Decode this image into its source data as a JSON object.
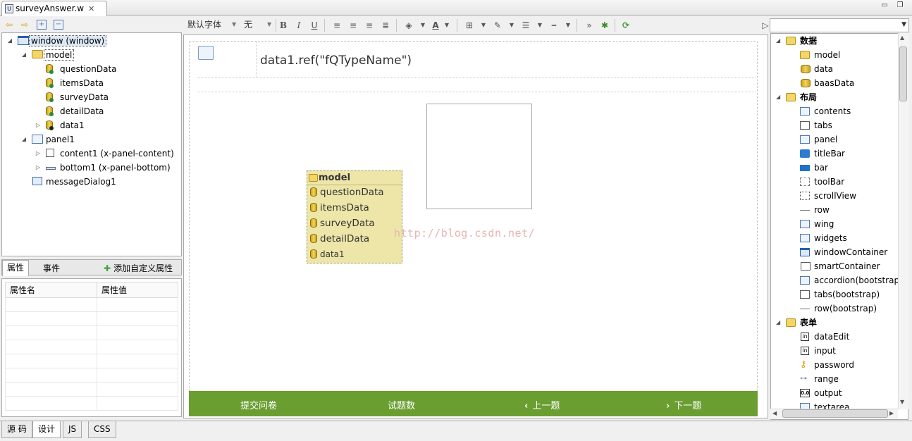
{
  "editor": {
    "tab_title": "surveyAnswer.w",
    "tab_close": "✕"
  },
  "outline": {
    "items": [
      {
        "label": "window (window)"
      },
      {
        "label": "model"
      },
      {
        "label": "questionData"
      },
      {
        "label": "itemsData"
      },
      {
        "label": "surveyData"
      },
      {
        "label": "detailData"
      },
      {
        "label": "data1"
      },
      {
        "label": "panel1"
      },
      {
        "label": "content1 (x-panel-content)"
      },
      {
        "label": "bottom1 (x-panel-bottom)"
      },
      {
        "label": "messageDialog1"
      }
    ]
  },
  "properties": {
    "tabs": [
      "属性",
      "事件"
    ],
    "add_custom": "添加自定义属性",
    "columns": [
      "属性名",
      "属性值"
    ]
  },
  "bottom_tabs": [
    "源 码",
    "设计",
    "JS",
    "CSS"
  ],
  "format_toolbar": {
    "font_family": "默认字体",
    "font_size": "无"
  },
  "canvas": {
    "ref_text": "data1.ref(\"fQTypeName\")",
    "model_box": {
      "title": "model",
      "items": [
        "questionData",
        "itemsData",
        "surveyData",
        "detailData",
        "data1"
      ]
    },
    "watermark": "http://blog.csdn.net/",
    "green_bar": {
      "submit": "提交问卷",
      "count": "试题数",
      "prev": "上一题",
      "next": "下一题"
    }
  },
  "palette": {
    "categories": [
      {
        "name": "数据",
        "items": [
          "model",
          "data",
          "baasData"
        ]
      },
      {
        "name": "布局",
        "items": [
          "contents",
          "tabs",
          "panel",
          "titleBar",
          "bar",
          "toolBar",
          "scrollView",
          "row",
          "wing",
          "widgets",
          "windowContainer",
          "smartContainer",
          "accordion(bootstrap",
          "tabs(bootstrap)",
          "row(bootstrap)"
        ]
      },
      {
        "name": "表单",
        "items": [
          "dataEdit",
          "input",
          "password",
          "range",
          "output",
          "textarea"
        ]
      }
    ]
  }
}
